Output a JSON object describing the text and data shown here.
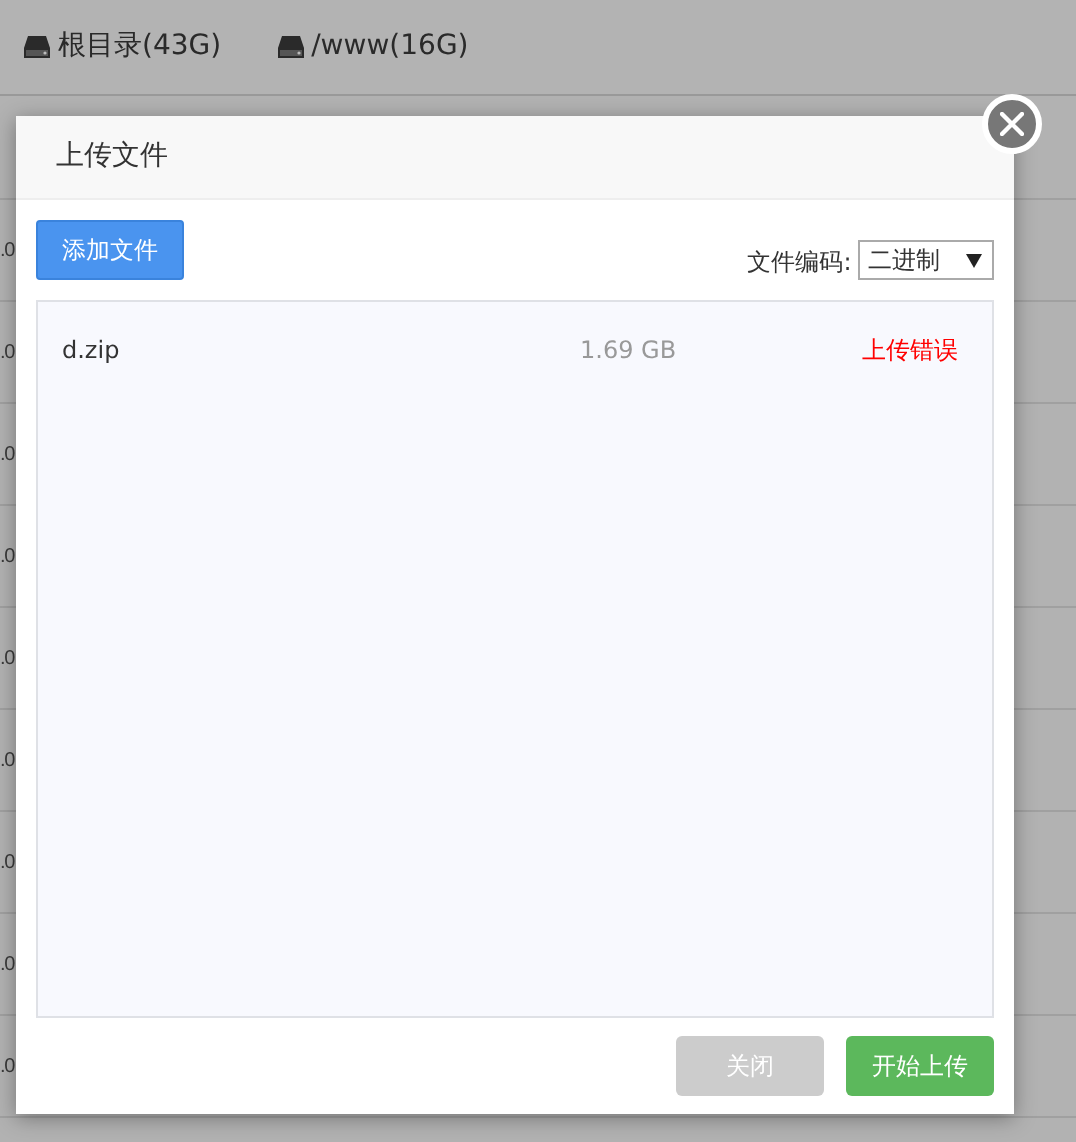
{
  "page": {
    "disks": [
      {
        "label": "根目录(43G)"
      },
      {
        "label": "/www(16G)"
      }
    ],
    "table": {
      "rows": [
        {
          "column_1": ".0"
        },
        {
          "column_1": ".0"
        },
        {
          "column_1": ".0"
        },
        {
          "column_1": ".0"
        },
        {
          "column_1": ".0"
        },
        {
          "column_1": ".0"
        },
        {
          "column_1": ".0"
        },
        {
          "column_1": ".0"
        },
        {
          "column_1": ".0"
        }
      ]
    }
  },
  "dialog": {
    "title": "上传文件",
    "add_button": "添加文件",
    "encoding_label": "文件编码:",
    "encoding_value": "二进制",
    "files": [
      {
        "name": "d.zip",
        "size": "1.69 GB",
        "status": "上传错误",
        "kind": "error"
      }
    ],
    "buttons": [
      {
        "label": "关闭",
        "kind": "secondary"
      },
      {
        "label": "开始上传",
        "kind": "primary"
      }
    ]
  }
}
